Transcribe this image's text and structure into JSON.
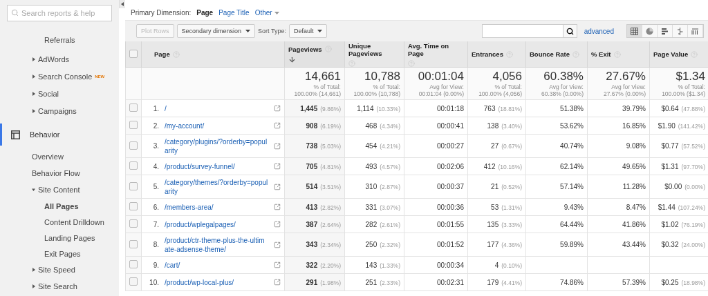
{
  "sidebar": {
    "search": {
      "placeholder": "Search reports & help"
    },
    "items": [
      {
        "label": "Referrals",
        "kind": "subpage",
        "selected": false
      },
      {
        "label": "AdWords",
        "kind": "group",
        "expanded": false
      },
      {
        "label": "Search Console",
        "kind": "group",
        "expanded": false,
        "badge": "NEW"
      },
      {
        "label": "Social",
        "kind": "group",
        "expanded": false
      },
      {
        "label": "Campaigns",
        "kind": "group",
        "expanded": false
      },
      {
        "label": "Behavior",
        "kind": "section",
        "selected": true,
        "children": [
          {
            "label": "Overview",
            "kind": "link",
            "selected": false
          },
          {
            "label": "Behavior Flow",
            "kind": "link",
            "selected": false
          },
          {
            "label": "Site Content",
            "kind": "group",
            "expanded": true,
            "children": [
              {
                "label": "All Pages",
                "kind": "subpage",
                "selected": true
              },
              {
                "label": "Content Drilldown",
                "kind": "subpage",
                "selected": false
              },
              {
                "label": "Landing Pages",
                "kind": "subpage",
                "selected": false
              },
              {
                "label": "Exit Pages",
                "kind": "subpage",
                "selected": false
              }
            ]
          },
          {
            "label": "Site Speed",
            "kind": "group",
            "expanded": false
          },
          {
            "label": "Site Search",
            "kind": "group",
            "expanded": false
          }
        ]
      }
    ]
  },
  "dimension_bar": {
    "label": "Primary Dimension:",
    "options": [
      {
        "label": "Page",
        "selected": true
      },
      {
        "label": "Page Title",
        "selected": false
      },
      {
        "label": "Other",
        "selected": false,
        "dropdown": true
      }
    ]
  },
  "toolbar": {
    "plot_rows": {
      "label": "Plot Rows",
      "disabled": true
    },
    "secondary_dimension": "Secondary dimension",
    "sort_label": "Sort Type:",
    "sort_value": "Default",
    "advanced": "advanced",
    "views": [
      {
        "kind": "table",
        "selected": true
      },
      {
        "kind": "pie",
        "selected": false
      },
      {
        "kind": "bars",
        "selected": false
      },
      {
        "kind": "comparison",
        "selected": false
      },
      {
        "kind": "pivot",
        "selected": false
      }
    ]
  },
  "table": {
    "header_checkbox": {
      "checked": false
    },
    "page_column": {
      "label": "Page",
      "help": true
    },
    "columns": [
      {
        "label": "Pageviews",
        "help": true,
        "sorted": true
      },
      {
        "label": "Unique Pageviews",
        "help": true,
        "sorted": false
      },
      {
        "label": "Avg. Time on Page",
        "help": true,
        "sorted": false
      },
      {
        "label": "Entrances",
        "help": true,
        "sorted": false
      },
      {
        "label": "Bounce Rate",
        "help": true,
        "sorted": false
      },
      {
        "label": "% Exit",
        "help": true,
        "sorted": false
      },
      {
        "label": "Page Value",
        "help": true,
        "sorted": false
      }
    ],
    "totals": [
      {
        "value": "14,661",
        "caption": "% of Total:",
        "detail": "100.00% (14,661)"
      },
      {
        "value": "10,788",
        "caption": "% of Total:",
        "detail": "100.00% (10,788)"
      },
      {
        "value": "00:01:04",
        "caption": "Avg for View:",
        "detail": "00:01:04 (0.00%)"
      },
      {
        "value": "4,056",
        "caption": "% of Total:",
        "detail": "100.00% (4,056)"
      },
      {
        "value": "60.38%",
        "caption": "Avg for View:",
        "detail": "60.38% (0.00%)"
      },
      {
        "value": "27.67%",
        "caption": "Avg for View:",
        "detail": "27.67% (0.00%)"
      },
      {
        "value": "$1.34",
        "caption": "% of Total:",
        "detail": "100.00% ($1.34)"
      }
    ],
    "rows": [
      {
        "index": "1.",
        "checked": false,
        "page": "/",
        "cells": [
          {
            "value": "1,445",
            "pct": "(9.86%)"
          },
          {
            "value": "1,114",
            "pct": "(10.33%)"
          },
          {
            "value": "00:01:18"
          },
          {
            "value": "763",
            "pct": "(18.81%)"
          },
          {
            "value": "51.38%"
          },
          {
            "value": "39.79%"
          },
          {
            "value": "$0.64",
            "pct": "(47.88%)"
          }
        ]
      },
      {
        "index": "2.",
        "checked": false,
        "page": "/my-account/",
        "cells": [
          {
            "value": "908",
            "pct": "(6.19%)"
          },
          {
            "value": "468",
            "pct": "(4.34%)"
          },
          {
            "value": "00:00:41"
          },
          {
            "value": "138",
            "pct": "(3.40%)"
          },
          {
            "value": "53.62%"
          },
          {
            "value": "16.85%"
          },
          {
            "value": "$1.90",
            "pct": "(141.42%)"
          }
        ]
      },
      {
        "index": "3.",
        "checked": false,
        "page": "/category/plugins/?orderby=popularity",
        "cells": [
          {
            "value": "738",
            "pct": "(5.03%)"
          },
          {
            "value": "454",
            "pct": "(4.21%)"
          },
          {
            "value": "00:00:27"
          },
          {
            "value": "27",
            "pct": "(0.67%)"
          },
          {
            "value": "40.74%"
          },
          {
            "value": "9.08%"
          },
          {
            "value": "$0.77",
            "pct": "(57.52%)"
          }
        ]
      },
      {
        "index": "4.",
        "checked": false,
        "page": "/product/survey-funnel/",
        "cells": [
          {
            "value": "705",
            "pct": "(4.81%)"
          },
          {
            "value": "493",
            "pct": "(4.57%)"
          },
          {
            "value": "00:02:06"
          },
          {
            "value": "412",
            "pct": "(10.16%)"
          },
          {
            "value": "62.14%"
          },
          {
            "value": "49.65%"
          },
          {
            "value": "$1.31",
            "pct": "(97.70%)"
          }
        ]
      },
      {
        "index": "5.",
        "checked": false,
        "page": "/category/themes/?orderby=popularity",
        "cells": [
          {
            "value": "514",
            "pct": "(3.51%)"
          },
          {
            "value": "310",
            "pct": "(2.87%)"
          },
          {
            "value": "00:00:37"
          },
          {
            "value": "21",
            "pct": "(0.52%)"
          },
          {
            "value": "57.14%"
          },
          {
            "value": "11.28%"
          },
          {
            "value": "$0.00",
            "pct": "(0.00%)"
          }
        ]
      },
      {
        "index": "6.",
        "checked": false,
        "page": "/members-area/",
        "cells": [
          {
            "value": "413",
            "pct": "(2.82%)"
          },
          {
            "value": "331",
            "pct": "(3.07%)"
          },
          {
            "value": "00:00:36"
          },
          {
            "value": "53",
            "pct": "(1.31%)"
          },
          {
            "value": "9.43%"
          },
          {
            "value": "8.47%"
          },
          {
            "value": "$1.44",
            "pct": "(107.24%)"
          }
        ]
      },
      {
        "index": "7.",
        "checked": false,
        "page": "/product/wplegalpages/",
        "cells": [
          {
            "value": "387",
            "pct": "(2.64%)"
          },
          {
            "value": "282",
            "pct": "(2.61%)"
          },
          {
            "value": "00:01:55"
          },
          {
            "value": "135",
            "pct": "(3.33%)"
          },
          {
            "value": "64.44%"
          },
          {
            "value": "41.86%"
          },
          {
            "value": "$1.02",
            "pct": "(76.19%)"
          }
        ]
      },
      {
        "index": "8.",
        "checked": false,
        "page": "/product/ctr-theme-plus-the-ultimate-adsense-theme/",
        "cells": [
          {
            "value": "343",
            "pct": "(2.34%)"
          },
          {
            "value": "250",
            "pct": "(2.32%)"
          },
          {
            "value": "00:01:52"
          },
          {
            "value": "177",
            "pct": "(4.36%)"
          },
          {
            "value": "59.89%"
          },
          {
            "value": "43.44%"
          },
          {
            "value": "$0.32",
            "pct": "(24.00%)"
          }
        ]
      },
      {
        "index": "9.",
        "checked": false,
        "page": "/cart/",
        "cells": [
          {
            "value": "322",
            "pct": "(2.20%)"
          },
          {
            "value": "143",
            "pct": "(1.33%)"
          },
          {
            "value": "00:00:34"
          },
          {
            "value": "4",
            "pct": "(0.10%)"
          },
          {},
          {},
          {}
        ]
      },
      {
        "index": "10.",
        "checked": false,
        "page": "/product/wp-local-plus/",
        "cells": [
          {
            "value": "291",
            "pct": "(1.98%)"
          },
          {
            "value": "251",
            "pct": "(2.33%)"
          },
          {
            "value": "00:02:31"
          },
          {
            "value": "179",
            "pct": "(4.41%)"
          },
          {
            "value": "74.86%"
          },
          {
            "value": "57.39%"
          },
          {
            "value": "$0.25",
            "pct": "(18.98%)"
          }
        ]
      }
    ]
  }
}
